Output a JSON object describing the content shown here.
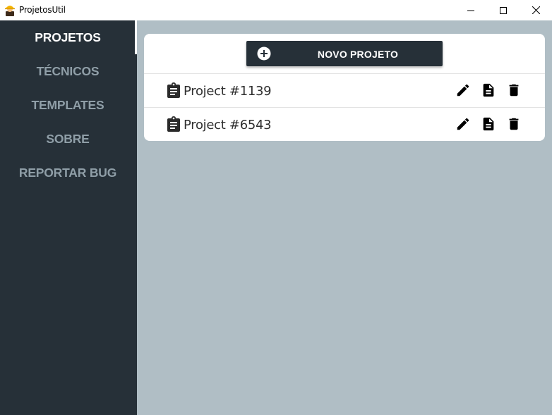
{
  "window": {
    "title": "ProjetosUtil"
  },
  "sidebar": {
    "items": [
      {
        "label": "PROJETOS",
        "active": true
      },
      {
        "label": "TÉCNICOS",
        "active": false
      },
      {
        "label": "TEMPLATES",
        "active": false
      },
      {
        "label": "SOBRE",
        "active": false
      },
      {
        "label": "REPORTAR BUG",
        "active": false
      }
    ]
  },
  "main": {
    "new_project_label": "NOVO PROJETO",
    "projects": [
      {
        "name": "Project #1139"
      },
      {
        "name": "Project #6543"
      }
    ]
  },
  "colors": {
    "sidebar_bg": "#263038",
    "main_bg": "#b0bec5",
    "nav_inactive": "#8f9ea7",
    "nav_active": "#ffffff"
  },
  "icons": {
    "app": "user-helmet-icon",
    "new": "add-circle-icon",
    "project": "clipboard-icon",
    "edit": "pencil-icon",
    "document": "document-icon",
    "delete": "trash-icon"
  }
}
